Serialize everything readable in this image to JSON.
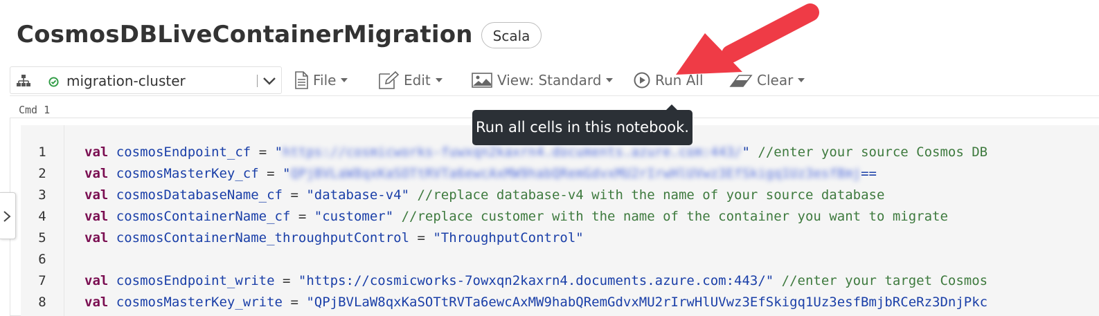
{
  "notebook": {
    "title": "CosmosDBLiveContainerMigration",
    "language": "Scala"
  },
  "toolbar": {
    "cluster_name": "migration-cluster",
    "file_label": "File",
    "edit_label": "Edit",
    "view_label": "View: Standard",
    "run_all_label": "Run All",
    "clear_label": "Clear"
  },
  "tooltip": {
    "text": "Run all cells in this notebook."
  },
  "cell": {
    "cmd_label": "Cmd 1",
    "lines": [
      {
        "number": "1",
        "kw": "val",
        "name": "cosmosEndpoint_cf",
        "op": " = ",
        "value": "\"",
        "redacted": "https://cosmicworks-fuwxqn2kaxrn4.documents.azure.com:443/",
        "value_end": "\"",
        "comment": " //enter your source Cosmos DB"
      },
      {
        "number": "2",
        "kw": "val",
        "name": "cosmosMasterKey_cf",
        "op": " = ",
        "value": "\"",
        "redacted": "QPjBVLaW8qxKaSOTtRVTa6ewcAxMW9habQRemGdvxMU2rIrwHlUVwz3EfSkigq1Uz3esfBmj",
        "value_end": "==",
        "comment": ""
      },
      {
        "number": "3",
        "kw": "val",
        "name": "cosmosDatabaseName_cf",
        "op": " = ",
        "value": "\"database-v4\"",
        "redacted": "",
        "value_end": "",
        "comment": " //replace database-v4 with the name of your source database"
      },
      {
        "number": "4",
        "kw": "val",
        "name": "cosmosContainerName_cf",
        "op": " = ",
        "value": "\"customer\"",
        "redacted": "",
        "value_end": "",
        "comment": " //replace customer with the name of the container you want to migrate"
      },
      {
        "number": "5",
        "kw": "val",
        "name": "cosmosContainerName_throughputControl",
        "op": " = ",
        "value": "\"ThroughputControl\"",
        "redacted": "",
        "value_end": "",
        "comment": ""
      },
      {
        "number": "6",
        "kw": "",
        "name": "",
        "op": "",
        "value": "",
        "redacted": "",
        "value_end": "",
        "comment": ""
      },
      {
        "number": "7",
        "kw": "val",
        "name": "cosmosEndpoint_write",
        "op": " = ",
        "value": "\"https://cosmicworks-7owxqn2kaxrn4.documents.azure.com:443/\"",
        "redacted": "",
        "value_end": "",
        "comment": " //enter your target Cosmos"
      },
      {
        "number": "8",
        "kw": "val",
        "name": "cosmosMasterKey_write",
        "op": " = ",
        "value": "\"QPjBVLaW8qxKaSOTtRVTa6ewcAxMW9habQRemGdvxMU2rIrwHlUVwz3EfSkigq1Uz3esfBmjbRCeRz3DnjPkc",
        "redacted": "",
        "value_end": "",
        "comment": ""
      }
    ]
  },
  "colors": {
    "keyword": "#7a0e51",
    "identifier": "#1a3fa8",
    "comment": "#3e7a3e",
    "arrow": "#ef3b46",
    "tooltip_bg": "#2b3036",
    "status_ok": "#2e9b43"
  },
  "icons": {
    "cluster": "cluster-tree-icon",
    "status": "check-circle-icon",
    "file": "file-icon",
    "edit": "edit-pencil-icon",
    "view": "image-icon",
    "run": "play-circle-icon",
    "clear": "eraser-icon",
    "sidebar": "chevron-right-icon"
  }
}
